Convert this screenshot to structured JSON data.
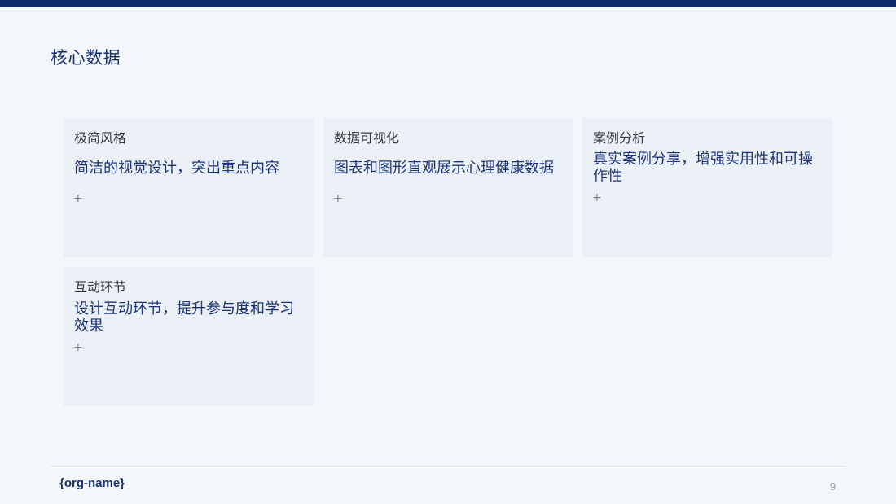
{
  "slide": {
    "title": "核心数据",
    "page_number": "9"
  },
  "cards": [
    {
      "title": "极简风格",
      "description": "简洁的视觉设计，突出重点内容",
      "plus": "+"
    },
    {
      "title": "数据可视化",
      "description": "图表和图形直观展示心理健康数据",
      "plus": "+"
    },
    {
      "title": "案例分析",
      "description": "真实案例分享，增强实用性和可操作性",
      "plus": "+"
    },
    {
      "title": "互动环节",
      "description": "设计互动环节，提升参与度和学习效果",
      "plus": "+"
    }
  ],
  "footer": {
    "org_name": "{org-name}"
  },
  "colors": {
    "top_bar": "#0d2b6b",
    "title": "#17306e",
    "card_background": "#ebf0f7",
    "page_background": "#f3f7fb"
  }
}
